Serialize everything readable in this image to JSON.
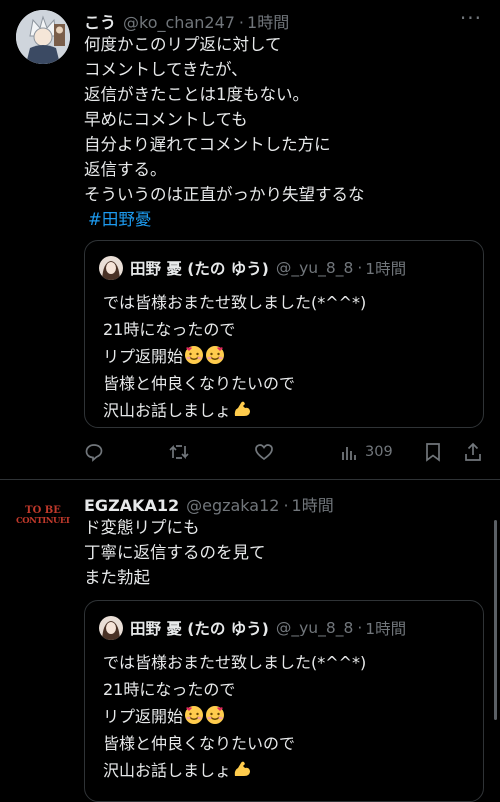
{
  "post1": {
    "display_name": "こう",
    "handle": "@ko_chan247",
    "sep": "·",
    "time": "1時間",
    "more": "···",
    "lines": [
      "何度かこのリプ返に対して",
      "コメントしてきたが、",
      "返信がきたことは1度もない。",
      "早めにコメントしても",
      "自分より遅れてコメントした方に",
      "返信する。",
      "そういうのは正直がっかり失望するな"
    ],
    "hashtag": "#田野憂",
    "quote": {
      "display_name": "田野 憂 (たの ゆう)",
      "handle": "@_yu_8_8",
      "sep": "·",
      "time": "1時間",
      "lines": [
        "では皆様おまたせ致しました(*^^*)",
        "21時になったので",
        "リプ返開始",
        "皆様と仲良くなりたいので",
        "沢山お話しましょ"
      ]
    },
    "actions": {
      "views": "309"
    }
  },
  "post2": {
    "display_name": "EGZAKA12",
    "handle": "@egzaka12",
    "sep": "·",
    "time": "1時間",
    "avatar_text": [
      "TO BE",
      "CONTINUED"
    ],
    "lines": [
      "ド変態リプにも",
      "丁寧に返信するのを見て",
      "また勃起"
    ],
    "quote": {
      "display_name": "田野 憂 (たの ゆう)",
      "handle": "@_yu_8_8",
      "sep": "·",
      "time": "1時間",
      "lines": [
        "では皆様おまたせ致しました(*^^*)",
        "21時になったので",
        "リプ返開始",
        "皆様と仲良くなりたいので",
        "沢山お話しましょ"
      ]
    }
  },
  "colors": {
    "background": "#000000",
    "text": "#e7e9ea",
    "muted": "#71767b",
    "link": "#1d9bf0",
    "border": "#2f3336"
  }
}
